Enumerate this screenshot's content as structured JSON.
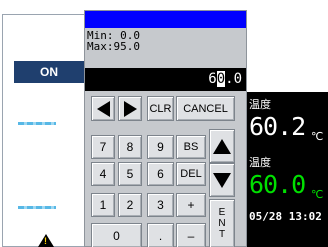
{
  "background": {
    "on_label": "ON",
    "temp1_label": "温度",
    "temp1_value": "60.2",
    "temp1_unit": "℃",
    "temp2_label": "温度",
    "temp2_value": "60.0",
    "temp2_unit": "℃",
    "datetime": "05/28 13:02",
    "colors": {
      "on_badge": "#1f3f6e",
      "temp1": "#ffffff",
      "temp2": "#00e000",
      "panel": "#000000"
    }
  },
  "keypad": {
    "title": "",
    "min_label": "Min: 0.0",
    "max_label": "Max:95.0",
    "display_value_prefix": "6",
    "display_value_cursor": "0",
    "display_value_suffix": ".0",
    "keys": {
      "clr": "CLR",
      "cancel": "CANCEL",
      "bs": "BS",
      "del": "DEL",
      "plus": "+",
      "minus": "–",
      "dot": ".",
      "enter": [
        "E",
        "N",
        "T"
      ],
      "digits": [
        "7",
        "8",
        "9",
        "4",
        "5",
        "6",
        "1",
        "2",
        "3",
        "0"
      ]
    },
    "colors": {
      "titlebar": "#0000ff",
      "display_bg": "#000000",
      "key_bg": "#dfe1e4"
    }
  }
}
